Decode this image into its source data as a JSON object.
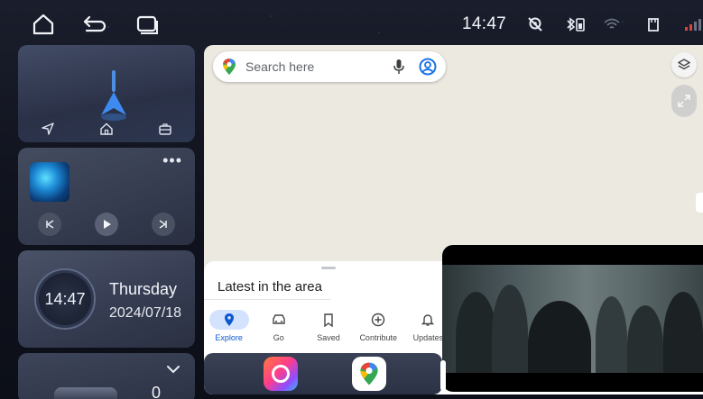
{
  "status_bar": {
    "time": "14:47",
    "left_icons": [
      "home-icon",
      "back-icon",
      "recents-icon"
    ],
    "right_icons": [
      "location-off-icon",
      "bluetooth-battery-icon",
      "wifi-icon",
      "sd-card-icon",
      "signal-icon"
    ]
  },
  "nav_widget": {
    "actions": [
      "navigate-icon",
      "home-icon",
      "work-icon"
    ]
  },
  "music_widget": {
    "more_label": "•••"
  },
  "clock_widget": {
    "time": "14:47",
    "day": "Thursday",
    "date": "2024/07/18"
  },
  "car_widget": {
    "value": "0"
  },
  "maps": {
    "search_placeholder": "Search here",
    "sheet_title": "Latest in the area",
    "tabs": [
      {
        "label": "Explore",
        "icon": "location-pin-icon",
        "active": true
      },
      {
        "label": "Go",
        "icon": "car-icon",
        "active": false
      },
      {
        "label": "Saved",
        "icon": "bookmark-icon",
        "active": false
      },
      {
        "label": "Contribute",
        "icon": "add-circle-icon",
        "active": false
      },
      {
        "label": "Updates",
        "icon": "bell-icon",
        "active": false
      }
    ]
  },
  "dock": {
    "apps": [
      "camera-app-icon",
      "maps-app-icon"
    ]
  },
  "colors": {
    "accent": "#0b57d0",
    "map_background": "#ece9e1"
  }
}
